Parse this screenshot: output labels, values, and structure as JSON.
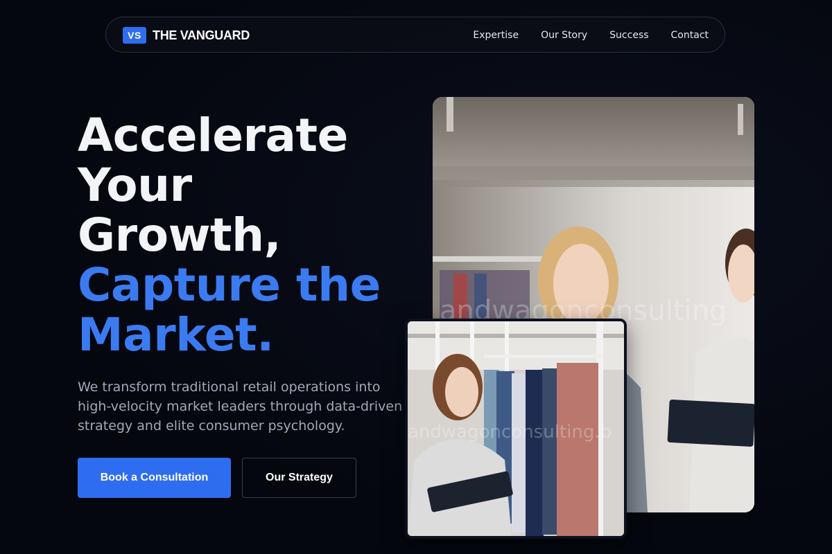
{
  "nav": {
    "logo_badge": "VS",
    "brand_name": "THE VANGUARD",
    "links": [
      "Expertise",
      "Our Story",
      "Success",
      "Contact"
    ]
  },
  "hero": {
    "headline_white": [
      "Accelerate",
      "Your",
      "Growth,"
    ],
    "headline_blue": [
      "Capture the",
      "Market."
    ],
    "subtext": "We transform traditional retail operations into high-velocity market leaders through data-driven strategy and elite consumer psychology.",
    "primary_button": "Book a Consultation",
    "secondary_button": "Our Strategy"
  },
  "images": {
    "large_watermark": "andwagonconsulting",
    "small_watermark": "andwagonconsulting.b"
  },
  "colors": {
    "background": "#05070f",
    "accent": "#2f6df0",
    "headline_blue": "#3b7bf2",
    "headline_white": "#f3f4f7",
    "subtext": "#a4a9b6"
  }
}
